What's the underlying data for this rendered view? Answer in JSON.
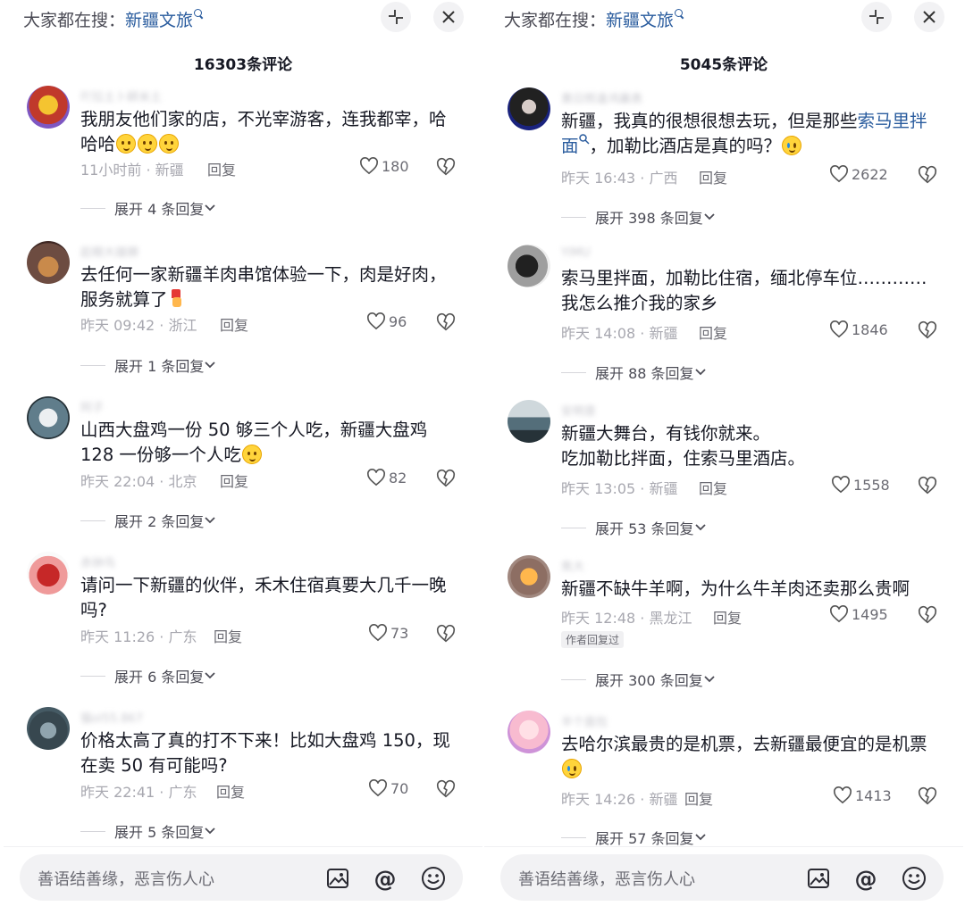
{
  "panels": [
    {
      "search_prefix": "大家都在搜：",
      "search_keyword": "新疆文旅",
      "comment_count": "16303条评论",
      "comments": [
        {
          "username": "吖拉土卜耕米土",
          "text": "我朋友他们家的店，不光宰游客，连我都宰，哈哈哈",
          "meta": "11小时前 · 新疆",
          "reply": "回复",
          "likes": "180",
          "expand": "展开 4 条回复"
        },
        {
          "username": "趁眼大雄狮",
          "text": "去任何一家新疆羊肉串馆体验一下，肉是好肉，服务就算了",
          "meta": "昨天 09:42 · 浙江",
          "reply": "回复",
          "likes": "96",
          "expand": "展开 1 条回复"
        },
        {
          "username": "阿子",
          "text": "山西大盘鸡一份 50 够三个人吃，新疆大盘鸡 128 一份够一个人吃",
          "meta": "昨天 22:04 · 北京",
          "reply": "回复",
          "likes": "82",
          "expand": "展开 2 条回复"
        },
        {
          "username": "赤钟鸟",
          "text": "请问一下新疆的伙伴，禾木住宿真要大几千一晚吗?",
          "meta": "昨天 11:26 · 广东",
          "reply": "回复",
          "likes": "73",
          "expand": "展开 6 条回复"
        },
        {
          "username": "猫ol55.867",
          "text": "价格太高了真的打不下来！比如大盘鸡 150，现在卖 50 有可能吗?",
          "meta": "昨天 22:41 · 广东",
          "reply": "回复",
          "likes": "70",
          "expand": "展开 5 条回复"
        }
      ],
      "input_placeholder": "善语结善缘，恶言伤人心"
    },
    {
      "search_prefix": "大家都在搜：",
      "search_keyword": "新疆文旅",
      "comment_count": "5045条评论",
      "comments": [
        {
          "username": "黄日照逢鸿襄表",
          "text_before": "新疆，我真的很想很想去玩，但是那些",
          "text_link": "索马里拌面",
          "text_after": "，加勒比酒店是真的吗？",
          "meta": "昨天 16:43 · 广西",
          "reply": "回复",
          "likes": "2622",
          "expand": "展开 398 条回复"
        },
        {
          "username": "YIMU",
          "text": "索马里拌面，加勒比住宿，缅北停车位…………我怎么推介我的家乡",
          "meta": "昨天 14:08 · 新疆",
          "reply": "回复",
          "likes": "1846",
          "expand": "展开 88 条回复"
        },
        {
          "username": "安明意",
          "text_line1": "新疆大舞台，有钱你就来。",
          "text_line2": "吃加勒比拌面，住索马里酒店。",
          "meta": "昨天 13:05 · 新疆",
          "reply": "回复",
          "likes": "1558",
          "expand": "展开 53 条回复"
        },
        {
          "username": "焦大",
          "text": "新疆不缺牛羊啊，为什么牛羊肉还卖那么贵啊",
          "meta": "昨天 12:48 · 黑龙江",
          "reply": "回复",
          "likes": "1495",
          "badge": "作者回复过",
          "expand": "展开 300 条回复"
        },
        {
          "username": "半个面包",
          "text": "去哈尔滨最贵的是机票，去新疆最便宜的是机票",
          "meta": "昨天 14:26 · 新疆",
          "reply": "回复",
          "likes": "1413",
          "expand": "展开 57 条回复"
        }
      ],
      "input_placeholder": "善语结善缘，恶言伤人心"
    }
  ],
  "colors": {
    "link": "#2a5c9e",
    "meta": "#a8a8b0",
    "text": "#161823",
    "input_bg": "#f2f2f4"
  },
  "icons": [
    "search-icon",
    "collapse-icon",
    "close-icon",
    "heart-icon",
    "dislike-icon",
    "chevron-down-icon",
    "image-icon",
    "at-icon",
    "smile-icon"
  ]
}
